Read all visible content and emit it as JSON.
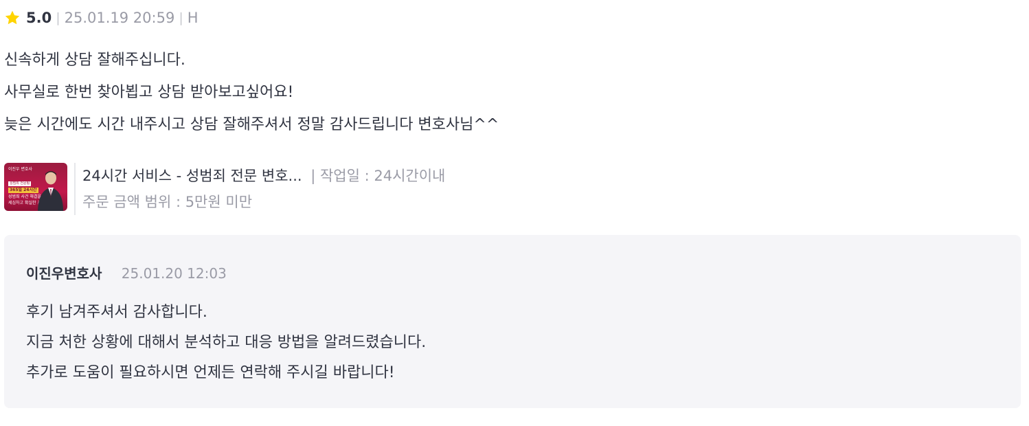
{
  "review": {
    "rating": "5.0",
    "date": "25.01.19 20:59",
    "author": "H",
    "lines": [
      "신속하게 상담 잘해주십니다.",
      "사무실로 한번 찾아뵙고 상담 받아보고싶어요!",
      "늦은 시간에도 시간 내주시고 상담 잘해주셔서 정말 감사드립니다 변호사님^^"
    ]
  },
  "service": {
    "title": "24시간 서비스 - 성범죄 전문 변호...",
    "work_period": "| 작업일 : 24시간이내",
    "price_range": "주문 금액 범위 : 5만원 미만",
    "thumbnail": {
      "top_text": "이진우 변호사",
      "tag_text": "성범죄 전문팀",
      "highlight_text": "365일 24시간",
      "line1": "성범죄 사건 해결을 위한",
      "line2": "세심하고 확실한 조력자"
    }
  },
  "reply": {
    "author": "이진우변호사",
    "date": "25.01.20 12:03",
    "lines": [
      "후기 남겨주셔서 감사합니다.",
      "지금 처한 상황에 대해서 분석하고 대응 방법을 알려드렸습니다.",
      "추가로 도움이 필요하시면 언제든 연락해 주시길 바랍니다!"
    ]
  },
  "colors": {
    "star": "#FFD400",
    "text": "#303441",
    "muted": "#9A9BA6",
    "reply_bg": "#F5F5F8",
    "thumb_brand": "#C2184B"
  },
  "icons": {
    "rating_icon": "star-icon"
  }
}
